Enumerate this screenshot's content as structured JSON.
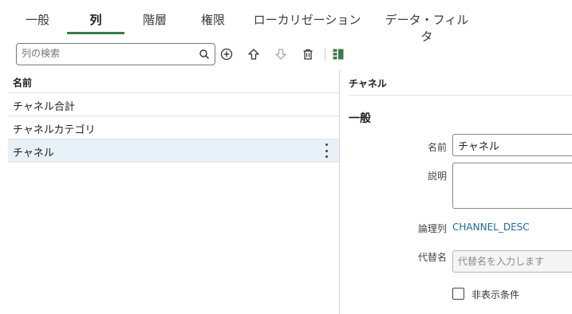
{
  "tabs": [
    {
      "label": "一般"
    },
    {
      "label": "列"
    },
    {
      "label": "階層"
    },
    {
      "label": "権限"
    },
    {
      "label": "ローカリゼーション"
    },
    {
      "label": "データ・フィルタ"
    }
  ],
  "active_tab": "列",
  "toolbar": {
    "search_placeholder": "列の検索",
    "icons": [
      "search-icon",
      "add-icon",
      "move-up-icon",
      "move-down-icon",
      "delete-icon",
      "columns-icon"
    ],
    "accent_color": "#3c7a4a"
  },
  "columns_list": {
    "header": "名前",
    "rows": [
      {
        "label": "チャネル合計"
      },
      {
        "label": "チャネルカテゴリ"
      },
      {
        "label": "チャネル"
      }
    ],
    "selected": "チャネル"
  },
  "detail": {
    "title": "チャネル",
    "section_general": "一般",
    "name_label": "名前",
    "name_value": "チャネル",
    "description_label": "説明",
    "description_value": "",
    "logical_column_label": "論理列",
    "logical_column_value": "CHANNEL_DESC",
    "alt_name_label": "代替名",
    "alt_name_placeholder": "代替名を入力します",
    "hide_condition_label": "非表示条件"
  }
}
